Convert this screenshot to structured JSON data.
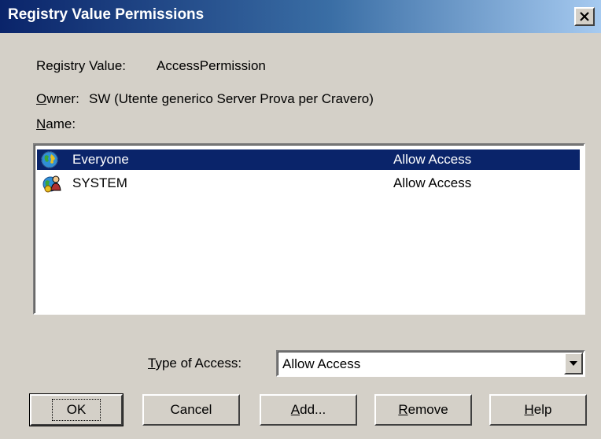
{
  "window": {
    "title": "Registry Value Permissions",
    "close_symbol": "✕"
  },
  "info": {
    "registry_value_label": "Registry Value:",
    "registry_value": "AccessPermission",
    "owner_mnemonic": "O",
    "owner_label_rest": "wner:",
    "owner_value": "SW (Utente generico Server Prova per Cravero)",
    "name_mnemonic": "N",
    "name_label_rest": "ame:"
  },
  "permissions": [
    {
      "name": "Everyone",
      "access": "Allow Access",
      "selected": true,
      "icon": "everyone-globe-icon"
    },
    {
      "name": "SYSTEM",
      "access": "Allow Access",
      "selected": false,
      "icon": "system-group-icon"
    }
  ],
  "type_of_access": {
    "mnemonic": "T",
    "label_rest": "ype of Access:",
    "value": "Allow Access"
  },
  "buttons": {
    "ok": "OK",
    "cancel": "Cancel",
    "add_mnemonic": "A",
    "add_rest": "dd...",
    "remove_mnemonic": "R",
    "remove_rest": "emove",
    "help_mnemonic": "H",
    "help_rest": "elp"
  },
  "colors": {
    "title_start": "#0a246a",
    "title_end": "#a6caf0",
    "face": "#d4d0c8",
    "selection": "#0a246a"
  }
}
